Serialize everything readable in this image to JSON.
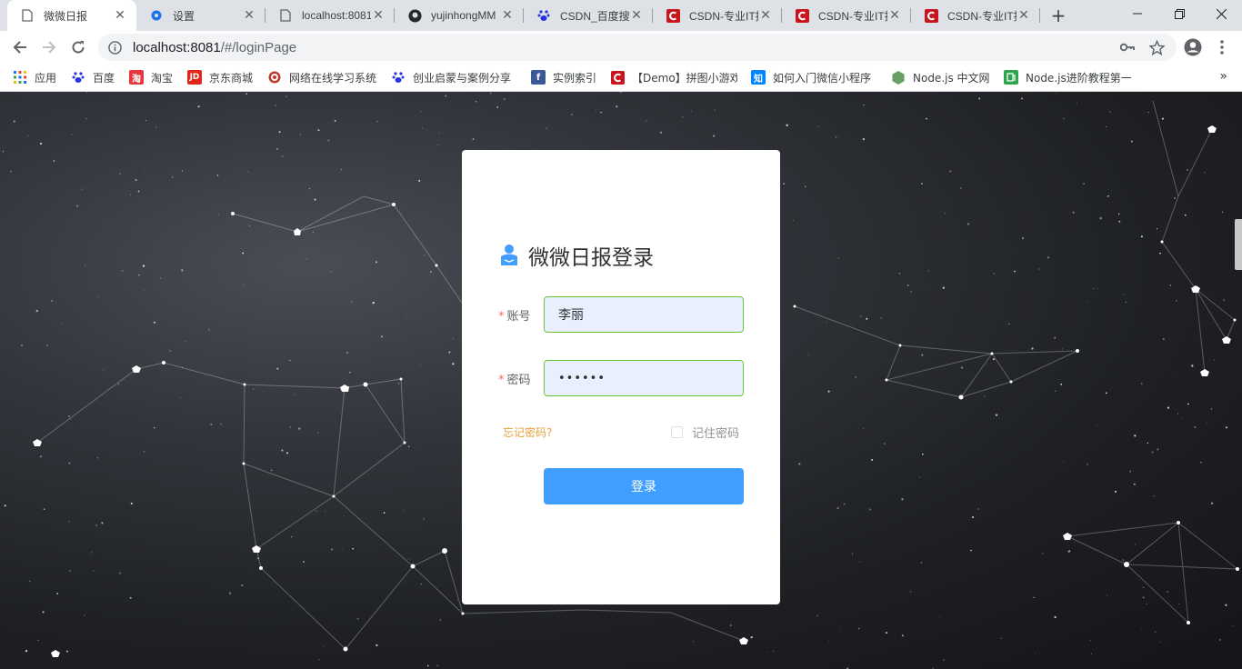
{
  "browser": {
    "tabs": [
      {
        "title": "微微日报",
        "icon": "page-icon",
        "active": true
      },
      {
        "title": "设置",
        "icon": "gear-icon",
        "active": false
      },
      {
        "title": "localhost:8081",
        "icon": "page-icon",
        "active": false
      },
      {
        "title": "yujinhongMM",
        "icon": "github-icon",
        "active": false
      },
      {
        "title": "CSDN_百度搜索",
        "icon": "baidu-paw-icon",
        "active": false
      },
      {
        "title": "CSDN-专业IT技",
        "icon": "csdn-icon",
        "active": false
      },
      {
        "title": "CSDN-专业IT技",
        "icon": "csdn-icon",
        "active": false
      },
      {
        "title": "CSDN-专业IT技",
        "icon": "csdn-icon",
        "active": false
      }
    ],
    "new_tab_glyph": "+",
    "address": {
      "host": "localhost:8081",
      "path": "/#/loginPage"
    },
    "bookmarks": [
      {
        "label": "应用",
        "icon": "apps-grid-icon",
        "color": "#1a73e8"
      },
      {
        "label": "百度",
        "icon": "baidu-paw-icon",
        "color": "#2932e1"
      },
      {
        "label": "淘宝",
        "icon": "taobao-icon",
        "color": "#e4393c"
      },
      {
        "label": "京东商城",
        "icon": "jd-icon",
        "color": "#e1251b"
      },
      {
        "label": "网络在线学习系统",
        "icon": "target-icon",
        "color": "#c0392b"
      },
      {
        "label": "创业启蒙与案例分享",
        "icon": "baidu-paw-icon",
        "color": "#2932e1"
      },
      {
        "label": "实例索引",
        "icon": "facebook-icon",
        "color": "#3b5998"
      },
      {
        "label": "【Demo】拼图小游戏",
        "icon": "csdn-icon",
        "color": "#c9151e"
      },
      {
        "label": "如何入门微信小程序",
        "icon": "zhihu-icon",
        "color": "#0084ff"
      },
      {
        "label": "Node.js 中文网",
        "icon": "nodejs-icon",
        "color": "#68a063"
      },
      {
        "label": "Node.js进阶教程第一",
        "icon": "book-icon",
        "color": "#2ea44f"
      }
    ]
  },
  "login": {
    "title": "微微日报登录",
    "account_label": "账号",
    "account_value": "李丽",
    "password_label": "密码",
    "password_value": "••••••",
    "required_mark": "*",
    "forgot_label": "忘记密码?",
    "remember_label": "记住密码",
    "remember_checked": false,
    "submit_label": "登录"
  },
  "colors": {
    "primary": "#409eff",
    "success_border": "#67c23a",
    "warning": "#e6a23c",
    "required": "#f56c6c"
  }
}
